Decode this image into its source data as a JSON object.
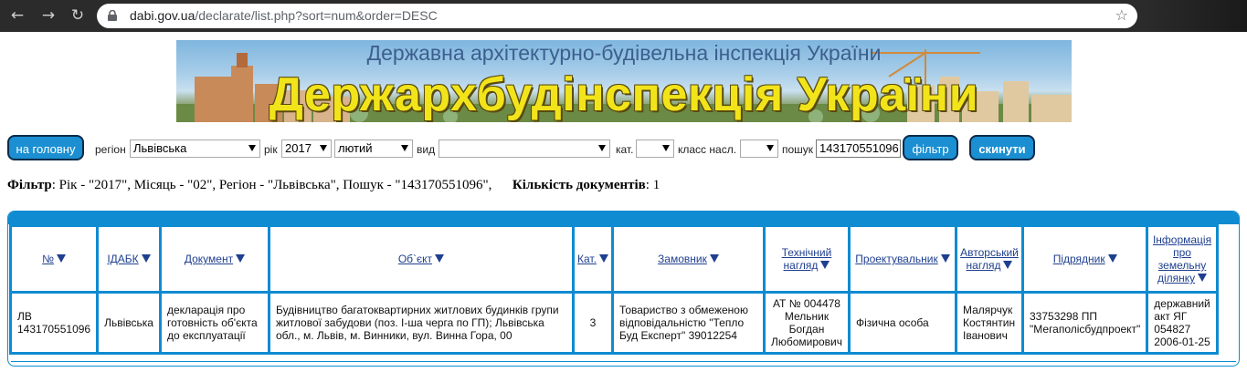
{
  "browser": {
    "url_host": "dabi.gov.ua",
    "url_path": "/declarate/list.php?sort=num&order=DESC",
    "back_icon": "←",
    "forward_icon": "→",
    "reload_icon": "↻",
    "star_icon": "☆"
  },
  "banner": {
    "subtitle": "Державна архітектурно-будівельна інспекція України",
    "title": "Держархбудінспекція України"
  },
  "filters": {
    "home_label": "на головну",
    "region_label": "регіон",
    "region_value": "Львівська",
    "year_label": "рік",
    "year_value": "2017",
    "month_value": "лютий",
    "kind_label": "вид",
    "kind_value": "",
    "cat_label": "кат.",
    "cat_value": "",
    "class_label": "класс насл.",
    "class_value": "",
    "search_label": "пошук",
    "search_value": "143170551096",
    "filter_button": "фільтр",
    "reset_button": "скинути"
  },
  "summary": {
    "filter_title": "Фільтр",
    "filter_text": ": Рік - \"2017\", Місяць - \"02\", Регіон - \"Львівська\", Пошук - \"143170551096\",",
    "count_title": "Кількість документів",
    "count_text": ": 1"
  },
  "table": {
    "headers": [
      "№",
      "ІДАБК",
      "Документ",
      "Об`єкт",
      "Кат.",
      "Замовник",
      "Технічний нагляд",
      "Проектувальник",
      "Авторський нагляд",
      "Підрядник",
      "Інформація про земельну ділянку"
    ],
    "rows": [
      [
        "ЛВ 143170551096",
        "Львівська",
        "декларація про готовність об'єкта до експлуатації",
        "Будівництво багатоквартирних житлових будинків групи житлової забудови (поз. І-ша черга по ГП); Львівська обл., м. Львів, м. Винники, вул. Винна Гора, 00",
        "3",
        "Товариство з обмеженою відповідальністю \"Тепло Буд Експерт\" 39012254",
        "АТ № 004478 Мельник Богдан Любомирович",
        "Фізична особа",
        "Малярчук Костянтин Іванович",
        "33753298 ПП \"Мегаполісбудпроект\"",
        "державний акт ЯГ 054827 2006-01-25"
      ]
    ]
  },
  "colors": {
    "accent": "#0f8bd1",
    "button": "#1b8fd1",
    "banner_title": "#f2e41a"
  }
}
